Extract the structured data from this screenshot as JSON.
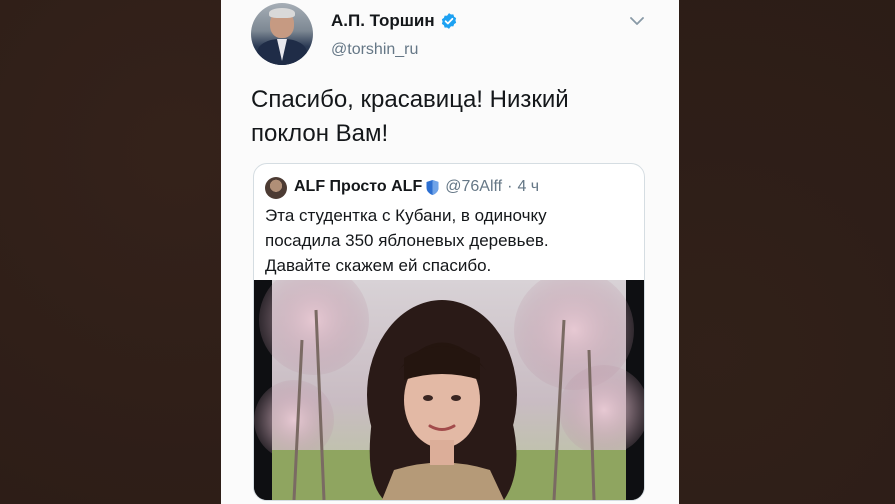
{
  "tweet": {
    "author_name": "А.П. Торшин",
    "author_handle": "@torshin_ru",
    "text_line1": "Спасибо, красавица! Низкий",
    "text_line2": "поклон Вам!"
  },
  "quoted_tweet": {
    "author_name": "ALF Просто ALF",
    "author_handle": "@76Alff",
    "separator": "·",
    "time": "4 ч",
    "text_line1": "Эта студентка с Кубани, в одиночку",
    "text_line2": "посадила 350 яблоневых деревьев.",
    "text_line3": "Давайте скажем ей спасибо."
  },
  "icons": {
    "verified": "verified-badge-icon",
    "menu": "chevron-down-icon",
    "quoted_badge": "shield-icon"
  },
  "colors": {
    "verified_blue": "#1da1f2",
    "text": "#14171a",
    "muted": "#657786",
    "background": "#2b1c16"
  }
}
